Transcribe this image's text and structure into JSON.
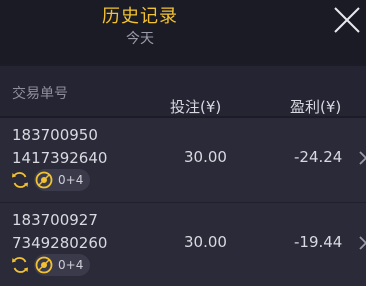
{
  "header": {
    "title": "历史记录",
    "subtitle": "今天"
  },
  "columns": {
    "order_id": "交易单号",
    "bet": "投注(¥)",
    "profit": "盈利(¥)"
  },
  "rows": [
    {
      "order_id_line1": "183700950",
      "order_id_line2": "1417392640",
      "bet": "30.00",
      "profit": "-24.24",
      "tag_count": "0+4"
    },
    {
      "order_id_line1": "183700927",
      "order_id_line2": "7349280260",
      "bet": "30.00",
      "profit": "-19.44",
      "tag_count": "0+4"
    }
  ],
  "colors": {
    "accent": "#f2c232",
    "background": "#1c1c27",
    "header_row": "#242432",
    "row": "#2a2a38"
  },
  "icons": {
    "close": "close-icon",
    "refresh": "refresh-icon",
    "ball": "ball-icon",
    "chevron": "chevron-right-icon"
  }
}
